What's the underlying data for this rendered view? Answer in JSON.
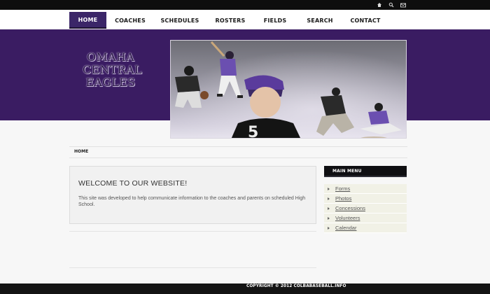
{
  "top_icons": [
    "home-icon",
    "search-icon",
    "mail-icon"
  ],
  "nav": {
    "items": [
      {
        "label": "HOME",
        "active": true
      },
      {
        "label": "COACHES",
        "active": false
      },
      {
        "label": "SCHEDULES",
        "active": false
      },
      {
        "label": "ROSTERS",
        "active": false
      },
      {
        "label": "FIELDS",
        "active": false
      },
      {
        "label": "SEARCH",
        "active": false
      },
      {
        "label": "CONTACT",
        "active": false
      }
    ]
  },
  "logo": {
    "line1": "OMAHA",
    "line2": "CENTRAL",
    "line3": "EAGLES"
  },
  "breadcrumb": {
    "home": "HOME"
  },
  "welcome": {
    "title": "WELCOME TO OUR WEBSITE!",
    "text": "This site was developed to help communicate information to the coaches and parents on scheduled High School."
  },
  "sidebar": {
    "title": "MAIN MENU",
    "items": [
      {
        "label": "Forms"
      },
      {
        "label": "Photos"
      },
      {
        "label": "Concessions"
      },
      {
        "label": "Volunteers"
      },
      {
        "label": "Calendar"
      }
    ]
  },
  "footer": {
    "copyright": "COPYRIGHT © 2012 COLBABASEBALL.INFO"
  },
  "colors": {
    "banner": "#3a1c62",
    "active_nav": "#3b2668",
    "dark": "#0e0e0e",
    "sidebar_item_bg": "#f1f1e6"
  }
}
